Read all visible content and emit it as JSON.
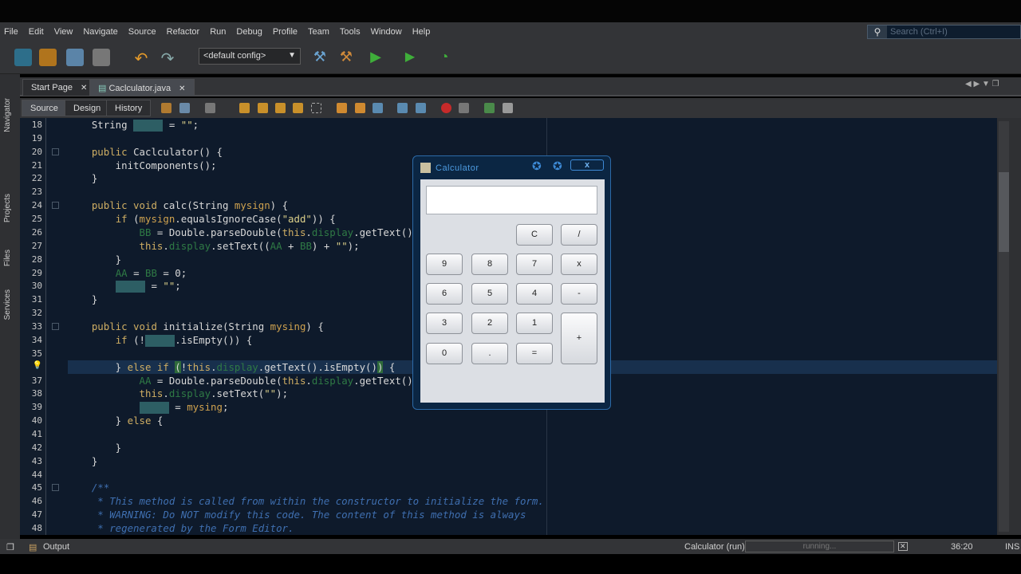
{
  "menu": [
    "File",
    "Edit",
    "View",
    "Navigate",
    "Source",
    "Refactor",
    "Run",
    "Debug",
    "Profile",
    "Team",
    "Tools",
    "Window",
    "Help"
  ],
  "search": {
    "placeholder": "Search (Ctrl+I)"
  },
  "toolbar": {
    "config": "<default config>"
  },
  "tabs": [
    {
      "label": "Start Page"
    },
    {
      "label": "Caclculator.java"
    }
  ],
  "views": [
    "Source",
    "Design",
    "History"
  ],
  "side_panels": [
    "Navigator",
    "Projects",
    "Files",
    "Services"
  ],
  "editor": {
    "lines": [
      {
        "n": "18",
        "t": [
          [
            "p",
            "    String "
          ],
          [
            "h",
            ""
          ],
          [
            "p",
            " = "
          ],
          [
            "s",
            "\"\""
          ],
          [
            "p",
            ";"
          ]
        ]
      },
      {
        "n": "19",
        "t": []
      },
      {
        "n": "20",
        "fold": true,
        "t": [
          [
            "p",
            "    "
          ],
          [
            "k",
            "public"
          ],
          [
            "p",
            " Caclculator() {"
          ]
        ]
      },
      {
        "n": "21",
        "t": [
          [
            "p",
            "        initComponents();"
          ]
        ]
      },
      {
        "n": "22",
        "t": [
          [
            "p",
            "    }"
          ]
        ]
      },
      {
        "n": "23",
        "t": []
      },
      {
        "n": "24",
        "fold": true,
        "t": [
          [
            "p",
            "    "
          ],
          [
            "k",
            "public void"
          ],
          [
            "p",
            " calc(String "
          ],
          [
            "pa",
            "mysign"
          ],
          [
            "p",
            ") {"
          ]
        ]
      },
      {
        "n": "25",
        "t": [
          [
            "p",
            "        "
          ],
          [
            "k",
            "if"
          ],
          [
            "p",
            " ("
          ],
          [
            "pa",
            "mysign"
          ],
          [
            "p",
            ".equalsIgnoreCase("
          ],
          [
            "s",
            "\"add\""
          ],
          [
            "p",
            ")) {"
          ]
        ]
      },
      {
        "n": "26",
        "t": [
          [
            "p",
            "            "
          ],
          [
            "f",
            "BB"
          ],
          [
            "p",
            " = Double.parseDouble("
          ],
          [
            "k",
            "this"
          ],
          [
            "p",
            "."
          ],
          [
            "f",
            "display"
          ],
          [
            "p",
            ".getText()"
          ]
        ]
      },
      {
        "n": "27",
        "t": [
          [
            "p",
            "            "
          ],
          [
            "k",
            "this"
          ],
          [
            "p",
            "."
          ],
          [
            "f",
            "display"
          ],
          [
            "p",
            ".setText(("
          ],
          [
            "f",
            "AA"
          ],
          [
            "p",
            " + "
          ],
          [
            "f",
            "BB"
          ],
          [
            "p",
            ") + "
          ],
          [
            "s",
            "\"\""
          ],
          [
            "p",
            ");"
          ]
        ]
      },
      {
        "n": "28",
        "t": [
          [
            "p",
            "        }"
          ]
        ]
      },
      {
        "n": "29",
        "t": [
          [
            "p",
            "        "
          ],
          [
            "f",
            "AA"
          ],
          [
            "p",
            " = "
          ],
          [
            "f",
            "BB"
          ],
          [
            "p",
            " = 0;"
          ]
        ]
      },
      {
        "n": "30",
        "t": [
          [
            "p",
            "        "
          ],
          [
            "h",
            ""
          ],
          [
            "p",
            " = "
          ],
          [
            "s",
            "\"\""
          ],
          [
            "p",
            ";"
          ]
        ]
      },
      {
        "n": "31",
        "t": [
          [
            "p",
            "    }"
          ]
        ]
      },
      {
        "n": "32",
        "t": []
      },
      {
        "n": "33",
        "fold": true,
        "t": [
          [
            "p",
            "    "
          ],
          [
            "k",
            "public void"
          ],
          [
            "p",
            " initialize(String "
          ],
          [
            "pa",
            "mysing"
          ],
          [
            "p",
            ") {"
          ]
        ]
      },
      {
        "n": "34",
        "t": [
          [
            "p",
            "        "
          ],
          [
            "k",
            "if"
          ],
          [
            "p",
            " (!"
          ],
          [
            "h",
            ""
          ],
          [
            "p",
            ".isEmpty()) {"
          ]
        ]
      },
      {
        "n": "35",
        "t": []
      },
      {
        "n": "",
        "bulb": true,
        "t": [
          [
            "p",
            "        } "
          ],
          [
            "k",
            "else if"
          ],
          [
            "p",
            " "
          ],
          [
            "m",
            "("
          ],
          [
            "p",
            "!"
          ],
          [
            "k",
            "this"
          ],
          [
            "p",
            "."
          ],
          [
            "f",
            "display"
          ],
          [
            "p",
            ".getText().isEmpty()"
          ],
          [
            "m",
            ")"
          ],
          [
            "p",
            " {"
          ]
        ]
      },
      {
        "n": "37",
        "t": [
          [
            "p",
            "            "
          ],
          [
            "f",
            "AA"
          ],
          [
            "p",
            " = Double.parseDouble("
          ],
          [
            "k",
            "this"
          ],
          [
            "p",
            "."
          ],
          [
            "f",
            "display"
          ],
          [
            "p",
            ".getText()"
          ]
        ]
      },
      {
        "n": "38",
        "t": [
          [
            "p",
            "            "
          ],
          [
            "k",
            "this"
          ],
          [
            "p",
            "."
          ],
          [
            "f",
            "display"
          ],
          [
            "p",
            ".setText("
          ],
          [
            "s",
            "\"\""
          ],
          [
            "p",
            ");"
          ]
        ]
      },
      {
        "n": "39",
        "t": [
          [
            "p",
            "            "
          ],
          [
            "h",
            ""
          ],
          [
            "p",
            " = "
          ],
          [
            "pa",
            "mysing"
          ],
          [
            "p",
            ";"
          ]
        ]
      },
      {
        "n": "40",
        "t": [
          [
            "p",
            "        } "
          ],
          [
            "k",
            "else"
          ],
          [
            "p",
            " {"
          ]
        ]
      },
      {
        "n": "41",
        "t": []
      },
      {
        "n": "42",
        "t": [
          [
            "p",
            "        }"
          ]
        ]
      },
      {
        "n": "43",
        "t": [
          [
            "p",
            "    }"
          ]
        ]
      },
      {
        "n": "44",
        "t": []
      },
      {
        "n": "45",
        "fold": true,
        "t": [
          [
            "c",
            "    /**"
          ]
        ]
      },
      {
        "n": "46",
        "t": [
          [
            "c",
            "     * This method is called from within the constructor to initialize the form."
          ]
        ]
      },
      {
        "n": "47",
        "t": [
          [
            "c",
            "     * WARNING: Do NOT modify this code. The content of this method is always"
          ]
        ]
      },
      {
        "n": "48",
        "t": [
          [
            "c",
            "     * regenerated by the Form Editor."
          ]
        ]
      }
    ]
  },
  "calculator": {
    "title": "Calculator",
    "close": "x",
    "display": "",
    "buttons": [
      [
        "C",
        "/"
      ],
      [
        "9",
        "8",
        "7",
        "x"
      ],
      [
        "6",
        "5",
        "4",
        "-"
      ],
      [
        "3",
        "2",
        "1",
        "+"
      ],
      [
        "0",
        ".",
        "="
      ]
    ]
  },
  "status": {
    "output": "Output",
    "task": "Calculator (run)",
    "progress": "running...",
    "position": "36:20",
    "mode": "INS"
  }
}
